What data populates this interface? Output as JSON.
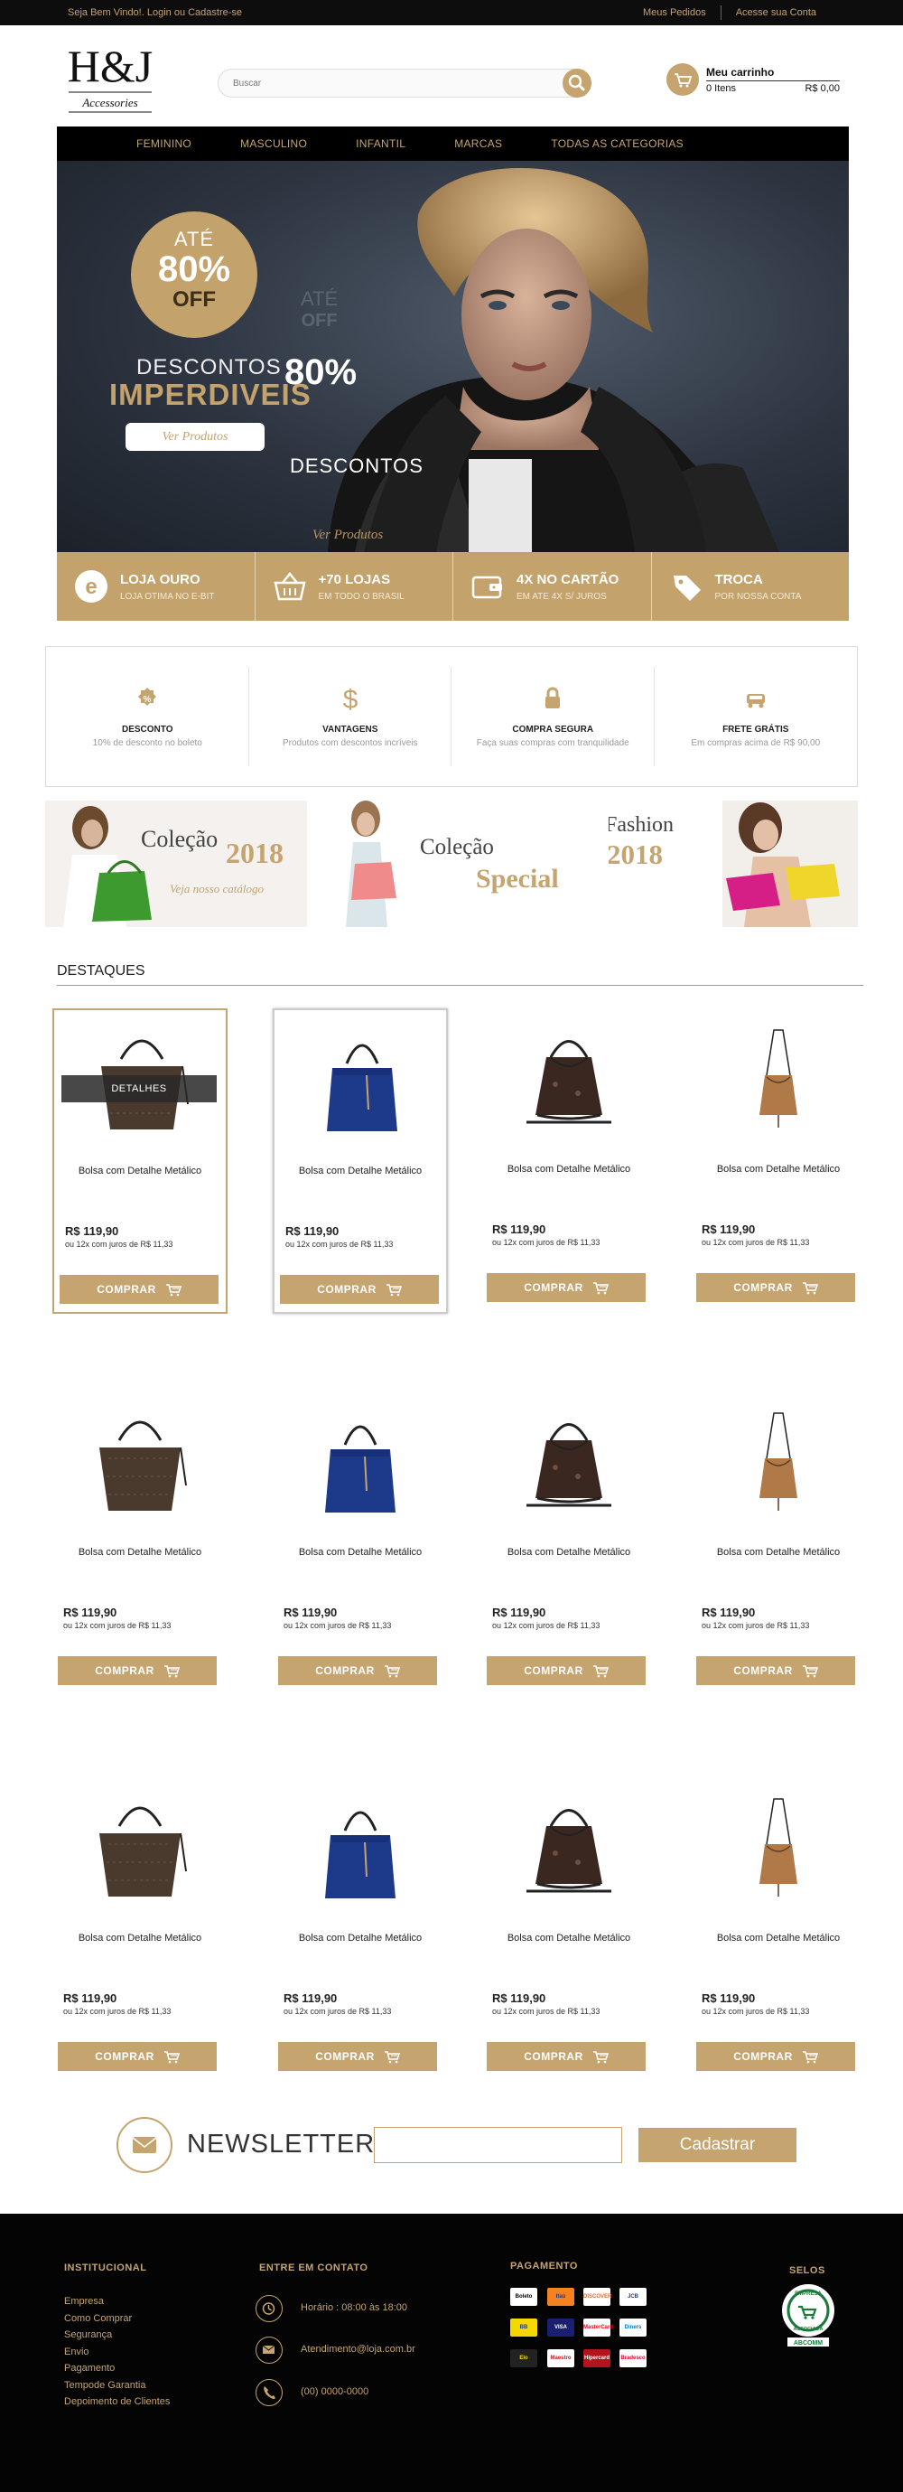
{
  "topbar": {
    "welcome": "Seja Bem Vindo!. Login  ou Cadastre-se",
    "orders": "Meus Pedidos",
    "account": "Acesse sua Conta"
  },
  "logo": {
    "mark": "H&J",
    "sub": "Accessories"
  },
  "search": {
    "placeholder": "Buscar"
  },
  "cart": {
    "title": "Meu carrinho",
    "items": "0 Itens",
    "total": "R$ 0,00"
  },
  "nav": [
    "FEMININO",
    "MASCULINO",
    "INFANTIL",
    "MARCAS",
    "TODAS AS CATEGORIAS"
  ],
  "hero": {
    "ate": "ATÉ",
    "percent": "80%",
    "off": "OFF",
    "descontos": "DESCONTOS",
    "imperdiveis": "IMPERDIVEIS",
    "cta": "Ver Produtos",
    "ghost_ate": "ATÉ",
    "ghost_off": "OFF",
    "ghost_percent": "80%",
    "ghost_desc": "DESCONTOS",
    "ghost_cta": "Ver Produtos"
  },
  "benefits": [
    {
      "title": "LOJA OURO",
      "sub": "LOJA OTIMA NO E-BIT",
      "icon": "ebit-icon"
    },
    {
      "title": "+70 LOJAS",
      "sub": "EM TODO O BRASIL",
      "icon": "basket-icon"
    },
    {
      "title": "4X NO CARTÃO",
      "sub": "EM ATE 4X S/ JUROS",
      "icon": "wallet-icon"
    },
    {
      "title": "TROCA",
      "sub": "POR NOSSA CONTA",
      "icon": "tag-icon"
    }
  ],
  "features": [
    {
      "title": "DESCONTO",
      "sub": "10% de desconto no boleto",
      "icon": "percent-icon"
    },
    {
      "title": "VANTAGENS",
      "sub": "Produtos com descontos incríveis",
      "icon": "dollar-icon"
    },
    {
      "title": "COMPRA SEGURA",
      "sub": "Faça suas compras com tranquilidade",
      "icon": "lock-icon"
    },
    {
      "title": "FRETE GRÁTIS",
      "sub": "Em compras acima de R$ 90,00",
      "icon": "truck-icon"
    }
  ],
  "banners": [
    {
      "l1": "Coleção",
      "l2": "2018",
      "l3": "Veja  nosso catálogo"
    },
    {
      "l1": "Coleção",
      "l2": "Special"
    },
    {
      "l1": "Fashion",
      "l2": "2018"
    }
  ],
  "destaques_title": "DESTAQUES",
  "product": {
    "name": "Bolsa com Detalhe Metálico",
    "price": "R$ 119,90",
    "installments": "ou 12x com juros de R$ 11,33",
    "buy": "COMPRAR",
    "details": "DETALHES"
  },
  "newsletter": {
    "title": "NEWSLETTER",
    "button": "Cadastrar"
  },
  "footer": {
    "institucional_title": "INSTITUCIONAL",
    "links": [
      "Empresa",
      "Como Comprar",
      "Segurança",
      "Envio",
      "Pagamento",
      "Tempode Garantia",
      "Depoimento de Clientes"
    ],
    "contato_title": "ENTRE EM CONTATO",
    "hours": "Horário : 08:00 às 18:00",
    "email": "Atendimento@loja.com.br",
    "phone": "(00) 0000-0000",
    "pagamento_title": "PAGAMENTO",
    "payments": [
      "Boleto",
      "Itaú",
      "DISCOVER",
      "JCB",
      "BB",
      "VISA",
      "MasterCard",
      "Diners",
      "Elo",
      "Maestro",
      "Hipercard",
      "Bradesco"
    ],
    "selos_title": "SELOS",
    "seal": {
      "top": "EMPRESA",
      "bottom": "ASSOCIADA",
      "brand": "ABCOMM"
    }
  },
  "colors": {
    "gold": "#c5a470",
    "dark": "#0d0d0d"
  }
}
